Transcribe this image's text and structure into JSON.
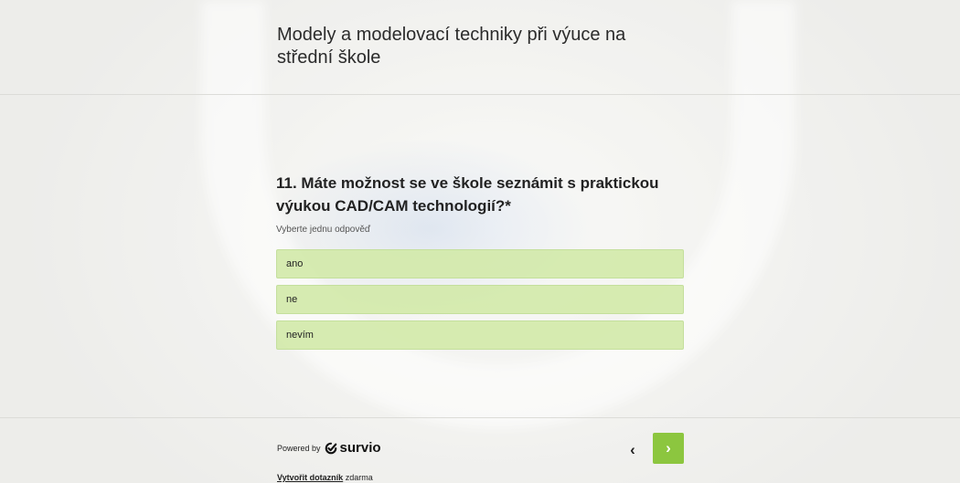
{
  "survey": {
    "title": "Modely a modelovací techniky při výuce na střední škole"
  },
  "question": {
    "title": "11. Máte možnost se ve škole seznámit s praktickou výukou CAD/CAM technologií?*",
    "hint": "Vyberte jednu odpověď",
    "options": [
      "ano",
      "ne",
      "nevím"
    ]
  },
  "footer": {
    "powered_by": "Powered by",
    "brand": "survio",
    "brand_icon": "survio-logo-icon",
    "prev_icon": "chevron-left-icon",
    "next_icon": "chevron-right-icon",
    "create_link": "Vytvořit dotazník",
    "create_suffix": "zdarma",
    "accent_color": "#8cc63f",
    "option_color": "#d2e9aa"
  }
}
